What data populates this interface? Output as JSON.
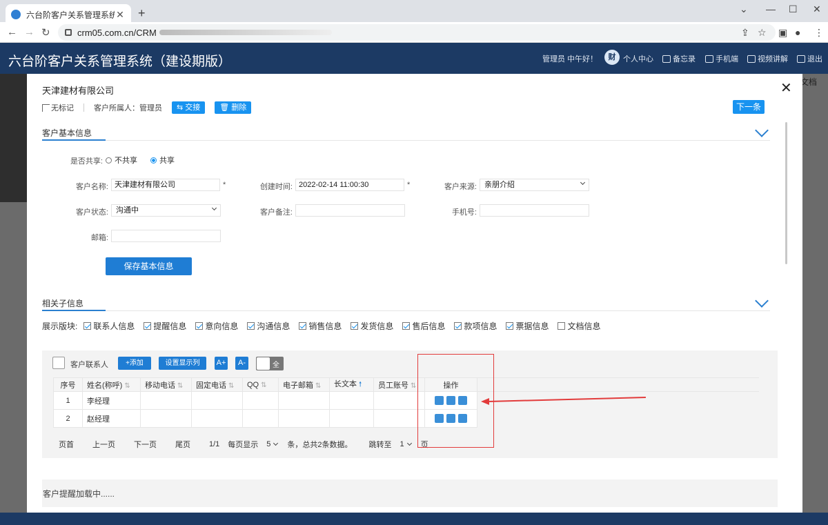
{
  "browser": {
    "tab_title": "六台阶客户关系管理系统（建设期",
    "url": "crm05.com.cn/CRM"
  },
  "app": {
    "title": "六台阶客户关系管理系统（建设期版）",
    "greeting": "管理员 中午好！",
    "avatar_text": "财",
    "nav": [
      "个人中心",
      "备忘录",
      "手机端",
      "视频讲解",
      "退出"
    ]
  },
  "bg": {
    "doc_text": "文档"
  },
  "modal": {
    "company": "天津建材有限公司",
    "mark_label": "无标记",
    "owner_label": "客户所属人：",
    "owner_value": "管理员",
    "handover_btn": "⇆ 交接",
    "delete_btn": "删除",
    "next_btn": "下一条",
    "basic": {
      "section_title": "客户基本信息",
      "share_label": "是否共享:",
      "share_options": [
        "不共享",
        "共享"
      ],
      "share_selected": "共享",
      "name_label": "客户名称:",
      "name_value": "天津建材有限公司",
      "created_label": "创建时间:",
      "created_value": "2022-02-14 11:00:30",
      "source_label": "客户来源:",
      "source_value": "亲朋介绍",
      "status_label": "客户状态:",
      "status_value": "沟通中",
      "remark_label": "客户备注:",
      "remark_value": "",
      "phone_label": "手机号:",
      "phone_value": "",
      "email_label": "邮箱:",
      "email_value": "",
      "required_mark": "*",
      "save_btn": "保存基本信息"
    },
    "related": {
      "section_title": "相关子信息",
      "modules_label": "展示版块:",
      "modules": [
        {
          "label": "联系人信息",
          "checked": true
        },
        {
          "label": "提醒信息",
          "checked": true
        },
        {
          "label": "意向信息",
          "checked": true
        },
        {
          "label": "沟通信息",
          "checked": true
        },
        {
          "label": "销售信息",
          "checked": true
        },
        {
          "label": "发货信息",
          "checked": true
        },
        {
          "label": "售后信息",
          "checked": true
        },
        {
          "label": "款项信息",
          "checked": true
        },
        {
          "label": "票据信息",
          "checked": true
        },
        {
          "label": "文档信息",
          "checked": false
        }
      ]
    },
    "contacts": {
      "title": "客户联系人",
      "add_btn": "+添加",
      "columns_btn": "设置显示列",
      "font_up": "A+",
      "font_down": "A-",
      "toggle_text": "全",
      "headers": [
        "序号",
        "姓名(称呼)",
        "移动电话",
        "固定电话",
        "QQ",
        "电子邮箱",
        "长文本",
        "员工账号",
        "操作"
      ],
      "rows": [
        {
          "no": "1",
          "name": "李经理"
        },
        {
          "no": "2",
          "name": "赵经理"
        }
      ],
      "pager": {
        "first": "页首",
        "prev": "上一页",
        "next": "下一页",
        "last": "尾页",
        "page": "1/1",
        "per_page_label": "每页显示",
        "per_page": "5",
        "summary": "条，总共2条数据。",
        "jump_label": "跳转至",
        "jump_value": "1",
        "page_unit": "页"
      }
    },
    "reminder_loading": "客户提醒加载中......"
  },
  "colors": {
    "header_bg": "#1c3a64",
    "accent": "#1f7dd4",
    "annotation": "#e23b3b"
  }
}
